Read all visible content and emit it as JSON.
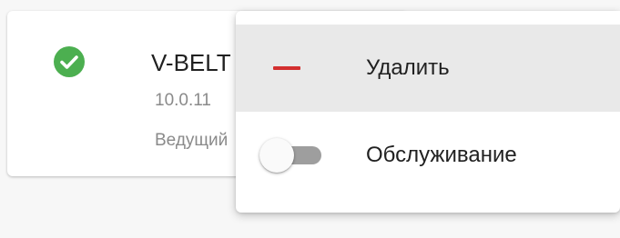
{
  "server_card": {
    "status_icon": "check-circle-icon",
    "status_color": "#4caf50",
    "name": "V-BELT",
    "ip": "10.0.11",
    "role": "Ведущий"
  },
  "context_menu": {
    "items": [
      {
        "label": "Удалить",
        "icon": "minus-icon",
        "icon_color": "#d32f2f",
        "highlighted": true
      },
      {
        "label": "Обслуживание",
        "icon": "toggle-switch",
        "toggle_state": "off"
      }
    ]
  }
}
